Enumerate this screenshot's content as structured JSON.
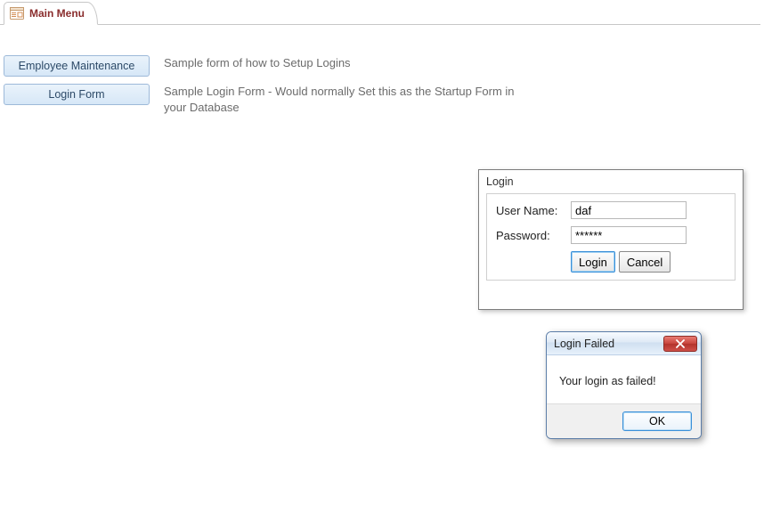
{
  "tab": {
    "title": "Main Menu"
  },
  "menu": {
    "rows": [
      {
        "button": "Employee Maintenance",
        "desc": "Sample form of how to Setup Logins"
      },
      {
        "button": "Login Form",
        "desc": "Sample Login Form - Would normally Set this as the Startup Form in your Database"
      }
    ]
  },
  "login_dialog": {
    "title": "Login",
    "username_label": "User Name:",
    "username_value": "daf",
    "password_label": "Password:",
    "password_value": "******",
    "login_btn": "Login",
    "cancel_btn": "Cancel"
  },
  "msgbox": {
    "title": "Login Failed",
    "body": "Your login as failed!",
    "ok": "OK"
  }
}
